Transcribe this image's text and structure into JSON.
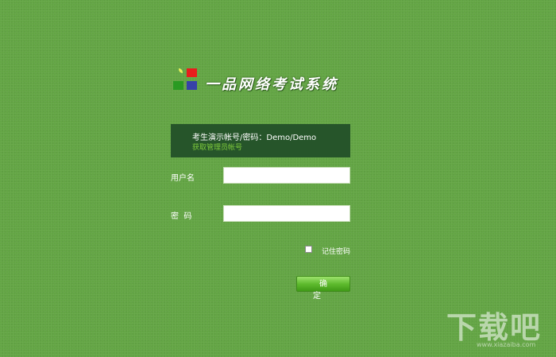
{
  "app": {
    "title": "一品网络考试系统"
  },
  "logo": {
    "colors": {
      "red": "#e81c1c",
      "green": "#2a9a22",
      "blue": "#3742a8",
      "leaf": "#e8f25a"
    }
  },
  "info": {
    "demo_account": "考生演示帐号/密码：Demo/Demo",
    "admin_link": "获取管理员帐号"
  },
  "form": {
    "username_label": "用户名",
    "username_value": "",
    "password_label": "密  码",
    "password_value": "",
    "remember_label": "记住密码",
    "remember_checked": false,
    "confirm_label": "确 定"
  },
  "watermark": {
    "text": "下载吧",
    "url": "www.xiazaiba.com"
  },
  "theme": {
    "background": "#63a544",
    "info_box": "#26552a",
    "link": "#7fca3c",
    "button": "#5fbb2e"
  }
}
